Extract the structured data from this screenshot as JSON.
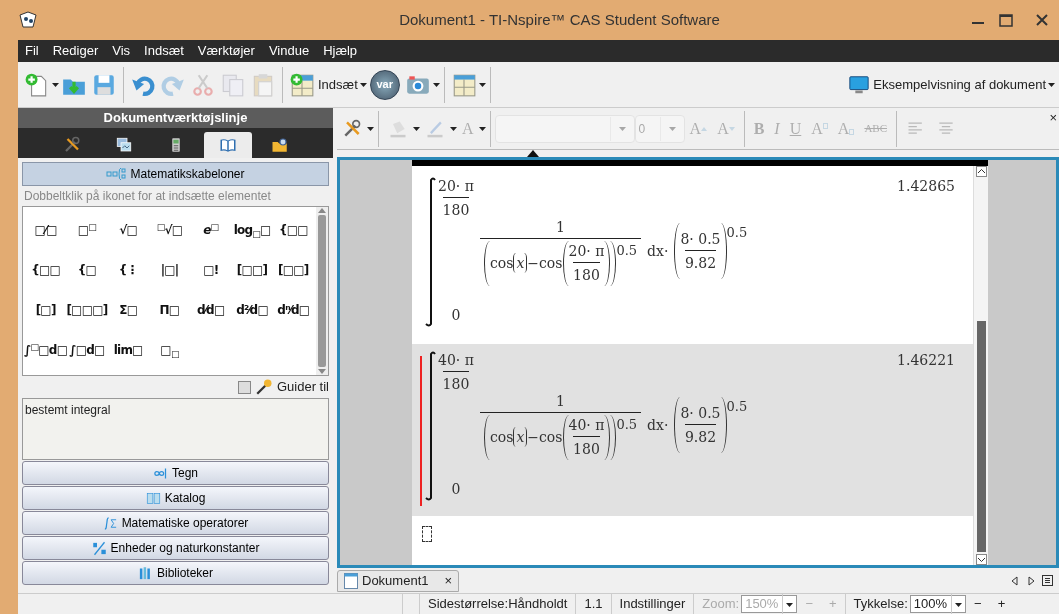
{
  "window": {
    "title": "Dokument1 - TI-Nspire™ CAS Student Software"
  },
  "menu": [
    "Fil",
    "Rediger",
    "Vis",
    "Indsæt",
    "Værktøjer",
    "Vindue",
    "Hjælp"
  ],
  "toolbar": [
    {
      "kind": "new",
      "caret": true,
      "disabled": false
    },
    {
      "kind": "open",
      "caret": false,
      "disabled": false
    },
    {
      "kind": "save",
      "caret": false,
      "disabled": false
    },
    {
      "kind": "separator"
    },
    {
      "kind": "undo",
      "caret": false,
      "disabled": false
    },
    {
      "kind": "redo",
      "caret": false,
      "disabled": true
    },
    {
      "kind": "cut",
      "caret": false,
      "disabled": true
    },
    {
      "kind": "copy",
      "caret": false,
      "disabled": true
    },
    {
      "kind": "paste",
      "caret": false,
      "disabled": true
    },
    {
      "kind": "separator"
    },
    {
      "kind": "insert",
      "label": "Indsæt",
      "caret": true,
      "disabled": false
    },
    {
      "kind": "var",
      "label": "var",
      "disabled": false
    },
    {
      "kind": "camera",
      "caret": true,
      "disabled": false
    },
    {
      "kind": "separator"
    },
    {
      "kind": "layout",
      "caret": true,
      "disabled": false
    },
    {
      "kind": "separator"
    }
  ],
  "preview_button": {
    "label": "Eksempelvisning af dokument"
  },
  "side_panel": {
    "title": "Dokumentværktøjslinje",
    "tabs": [
      {
        "kind": "tools",
        "selected": false
      },
      {
        "kind": "graphs",
        "selected": false
      },
      {
        "kind": "calculator",
        "selected": false
      },
      {
        "kind": "book",
        "selected": true
      },
      {
        "kind": "folder",
        "selected": false
      }
    ],
    "section": "Matematikskabeloner",
    "hint": "Dobbeltklik på ikonet for at indsætte elementet",
    "templates": [
      {
        "glyph": "□⁄□"
      },
      {
        "glyph": "□$^{□}$"
      },
      {
        "glyph": "√□"
      },
      {
        "glyph": "$^{□}$√□"
      },
      {
        "glyph": "*e*$^{□}$"
      },
      {
        "glyph": "log$_{□}$□"
      },
      {
        "glyph": "{□□"
      },
      {
        "glyph": "{□□"
      },
      {
        "glyph": "{□"
      },
      {
        "glyph": "{⋮"
      },
      {
        "glyph": "|□|"
      },
      {
        "glyph": "□!"
      },
      {
        "glyph": "[□□]"
      },
      {
        "glyph": "[□□]"
      },
      {
        "glyph": "[□]"
      },
      {
        "glyph": "[□□□]"
      },
      {
        "glyph": "Σ□"
      },
      {
        "glyph": "Π□"
      },
      {
        "glyph": "d⁄d□"
      },
      {
        "glyph": "d²⁄d□"
      },
      {
        "glyph": "dⁿ⁄d□"
      },
      {
        "glyph": "∫$^{□}$□d□"
      },
      {
        "glyph": "∫□d□"
      },
      {
        "glyph": "lim□"
      },
      {
        "glyph": "□$_{□}$"
      }
    ],
    "wizard": {
      "label": "Guider til",
      "checked": false
    },
    "description": "bestemt integral",
    "sections": [
      {
        "kind": "symbols",
        "label": "Tegn"
      },
      {
        "kind": "catalog",
        "label": "Katalog"
      },
      {
        "kind": "operators",
        "label": "Matematiske operatorer"
      },
      {
        "kind": "units",
        "label": "Enheder og naturkonstanter"
      },
      {
        "kind": "libraries",
        "label": "Biblioteker"
      }
    ]
  },
  "format_toolbar": [
    {
      "kind": "tools",
      "caret": true,
      "disabled": false
    },
    {
      "kind": "separator"
    },
    {
      "kind": "fill",
      "caret": true,
      "disabled": true
    },
    {
      "kind": "pen",
      "caret": true,
      "disabled": true
    },
    {
      "kind": "letter",
      "label": "A",
      "caret": true,
      "disabled": true
    },
    {
      "kind": "separator"
    },
    {
      "kind": "font-combo",
      "disabled": true
    },
    {
      "kind": "size-combo",
      "value": "0",
      "disabled": true
    },
    {
      "kind": "grow",
      "label": "A",
      "disabled": true
    },
    {
      "kind": "shrink",
      "label": "A",
      "disabled": true
    },
    {
      "kind": "separator"
    },
    {
      "kind": "bold",
      "label": "B",
      "disabled": true
    },
    {
      "kind": "italic",
      "label": "I",
      "disabled": true
    },
    {
      "kind": "underline",
      "label": "U",
      "disabled": true
    },
    {
      "kind": "superscript",
      "label": "A",
      "disabled": true
    },
    {
      "kind": "subscript",
      "label": "A",
      "disabled": true
    },
    {
      "kind": "strike",
      "label": "ABC",
      "disabled": true
    },
    {
      "kind": "separator"
    },
    {
      "kind": "align-left",
      "disabled": true
    },
    {
      "kind": "align-center",
      "disabled": true
    }
  ],
  "format_close": "×",
  "entries": [
    {
      "upper": {
        "num": "20· π",
        "den": "180"
      },
      "lower": "0",
      "num": "1",
      "fn1": "cos",
      "var": "x",
      "minus": "−",
      "fn2": "cos",
      "angle": {
        "num": "20· π",
        "den": "180"
      },
      "inner_exp": "0.5",
      "dx": "dx·",
      "factor": {
        "num": "8· 0.5",
        "den": "9.82"
      },
      "outer_exp": "0.5",
      "result": "1.42865",
      "selected": false
    },
    {
      "upper": {
        "num": "40· π",
        "den": "180"
      },
      "lower": "0",
      "num": "1",
      "fn1": "cos",
      "var": "x",
      "minus": "−",
      "fn2": "cos",
      "angle": {
        "num": "40· π",
        "den": "180"
      },
      "inner_exp": "0.5",
      "dx": "dx·",
      "factor": {
        "num": "8· 0.5",
        "den": "9.82"
      },
      "outer_exp": "0.5",
      "result": "1.46221",
      "selected": true
    }
  ],
  "document_tabs": [
    {
      "label": "Dokument1",
      "close": "×",
      "selected": true
    }
  ],
  "status_bar": [
    {
      "kind": "text",
      "text": "Sidestørrelse:Håndholdt",
      "disabled": false
    },
    {
      "kind": "text",
      "text": "1.1",
      "disabled": false
    },
    {
      "kind": "text",
      "text": "Indstillinger",
      "disabled": false
    },
    {
      "kind": "label",
      "text": "Zoom:",
      "disabled": true
    },
    {
      "kind": "combo",
      "text": "150%",
      "disabled": true
    },
    {
      "kind": "button",
      "text": "−",
      "disabled": true
    },
    {
      "kind": "button",
      "text": "+",
      "disabled": true
    },
    {
      "kind": "label",
      "text": "Tykkelse:",
      "disabled": false
    },
    {
      "kind": "combo",
      "text": "100%",
      "disabled": false
    },
    {
      "kind": "button",
      "text": "−",
      "disabled": false
    },
    {
      "kind": "button",
      "text": "+",
      "disabled": false
    }
  ]
}
